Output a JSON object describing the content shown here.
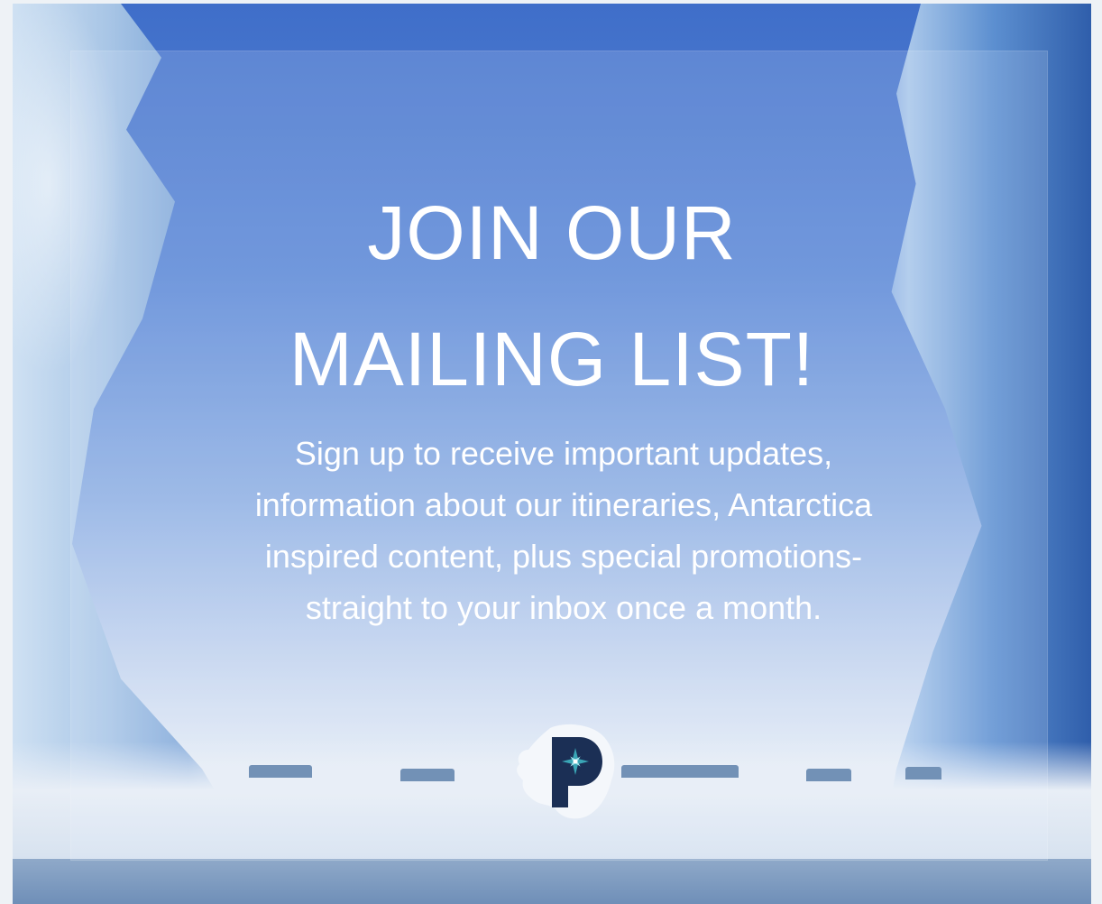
{
  "headline": {
    "line1": "JOIN OUR",
    "line2": "MAILING LIST!"
  },
  "description": {
    "line1": "Sign up to receive important updates,",
    "line2": "information about our itineraries, Antarctica",
    "line3": "inspired content, plus special promotions-",
    "line4": "straight to your inbox once a month."
  },
  "logo": {
    "letter": "P",
    "icon": "compass-star-icon"
  },
  "colors": {
    "sky_top": "#3f6ec9",
    "text": "#ffffff",
    "logo_navy": "#1b2f55",
    "logo_teal": "#3aa6b6"
  }
}
